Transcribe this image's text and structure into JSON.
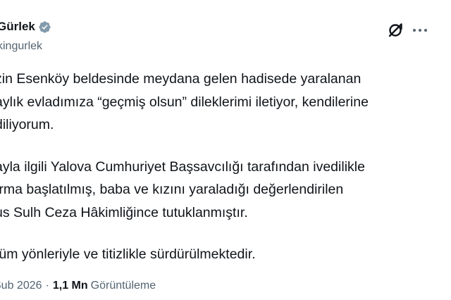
{
  "author": {
    "display_name": "Gürlek",
    "handle": "kingurlek",
    "verified": true
  },
  "icons": {
    "verified": "verified-badge-icon",
    "grok": "grok-icon",
    "more": "more-options-icon"
  },
  "colors": {
    "verified_badge": "#829aab",
    "text": "#0f1419",
    "secondary_text": "#536471"
  },
  "tweet": {
    "paragraphs": [
      {
        "lines": [
          "zin Esenköy beldesinde meydana gelen hadisede yaralanan",
          "aylık evladımıza “geçmiş olsun” dileklerimi iletiyor, kendilerine",
          "diliyorum."
        ]
      },
      {
        "lines": [
          "ayla ilgili Yalova Cumhuriyet Başsavcılığı tarafından ivedilikle",
          "ırma başlatılmış, baba ve kızını yaraladığı değerlendirilen",
          "us Sulh Ceza Hâkimliğince tutuklanmıştır."
        ]
      },
      {
        "lines": [
          "tüm yönleriyle ve titizlikle sürdürülmektedir."
        ]
      }
    ]
  },
  "meta": {
    "date": "Şub 2026",
    "separator": "·",
    "views_count": "1,1 Mn",
    "views_label": "Görüntüleme"
  }
}
